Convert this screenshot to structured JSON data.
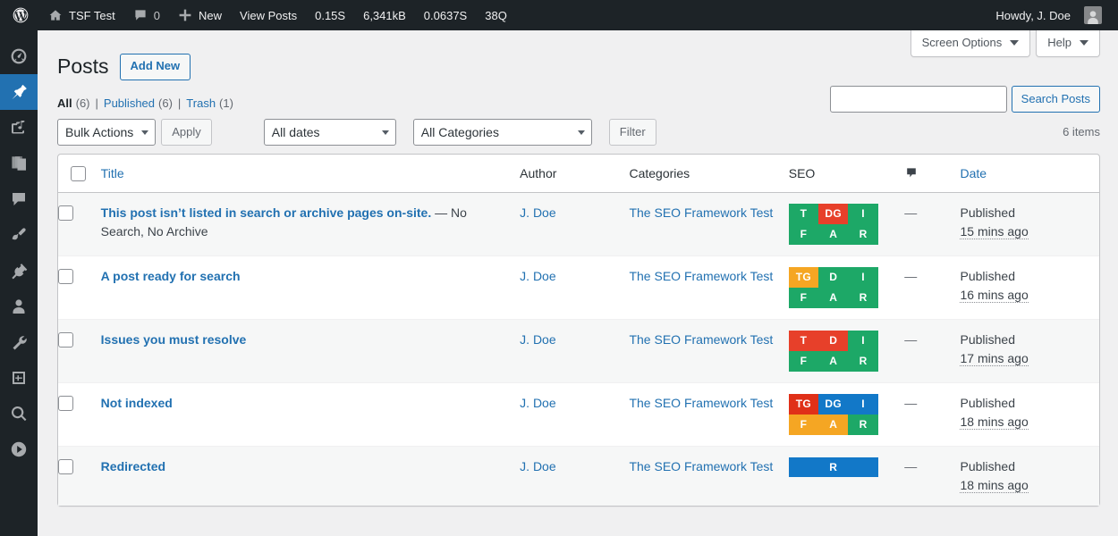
{
  "adminbar": {
    "logo_icon": "wordpress-logo-icon",
    "site_name": "TSF Test",
    "site_icon": "home-icon",
    "comments_icon": "comment-bubble-icon",
    "comments_count": "0",
    "new_icon": "plus-icon",
    "new_label": "New",
    "view_posts_label": "View Posts",
    "perf_time": "0.15S",
    "perf_memory": "6,341kB",
    "perf_time2": "0.0637S",
    "perf_queries": "38Q",
    "howdy": "Howdy, J. Doe",
    "avatar_icon": "user-avatar-icon"
  },
  "sidebar": {
    "items": [
      {
        "name": "dashboard",
        "icon": "dashboard-gauge-icon",
        "current": false
      },
      {
        "name": "posts",
        "icon": "pushpin-icon",
        "current": true
      },
      {
        "name": "media",
        "icon": "media-camera-music-icon",
        "current": false
      },
      {
        "name": "pages",
        "icon": "pages-stack-icon",
        "current": false
      },
      {
        "name": "comments",
        "icon": "comment-bubble-icon",
        "current": false
      },
      {
        "name": "appearance",
        "icon": "paintbrush-icon",
        "current": false
      },
      {
        "name": "plugins",
        "icon": "plug-icon",
        "current": false
      },
      {
        "name": "users",
        "icon": "user-icon",
        "current": false
      },
      {
        "name": "tools",
        "icon": "wrench-icon",
        "current": false
      },
      {
        "name": "settings",
        "icon": "sliders-settings-icon",
        "current": false
      },
      {
        "name": "seo",
        "icon": "magnifier-search-icon",
        "current": false
      },
      {
        "name": "collapse-menu",
        "icon": "play-circle-icon",
        "current": false
      }
    ]
  },
  "screen_meta": {
    "screen_options_label": "Screen Options",
    "help_label": "Help"
  },
  "header": {
    "page_title": "Posts",
    "add_new_label": "Add New"
  },
  "views": {
    "all_label": "All",
    "all_count": "(6)",
    "published_label": "Published",
    "published_count": "(6)",
    "trash_label": "Trash",
    "trash_count": "(1)",
    "divider": "|"
  },
  "search": {
    "value": "",
    "placeholder": "",
    "button_label": "Search Posts"
  },
  "tablenav": {
    "bulk_actions": "Bulk Actions",
    "apply_label": "Apply",
    "all_dates": "All dates",
    "all_categories": "All Categories",
    "filter_label": "Filter",
    "displaying_num": "6 items"
  },
  "table": {
    "columns": {
      "title": "Title",
      "author": "Author",
      "categories": "Categories",
      "seo": "SEO",
      "comments_icon": "comment-bubble-icon",
      "date": "Date"
    },
    "rows": [
      {
        "title": "This post isn’t listed in search or archive pages on-site.",
        "state": "— No Search, No Archive",
        "author": "J. Doe",
        "category": "The SEO Framework Test",
        "comments": "—",
        "date_status": "Published",
        "date_time": "15 mins ago",
        "seo": {
          "layout": "grid",
          "cells": [
            {
              "label": "T",
              "color": "#1da867"
            },
            {
              "label": "DG",
              "color": "#e7402a"
            },
            {
              "label": "I",
              "color": "#1da867"
            },
            {
              "label": "F",
              "color": "#1da867"
            },
            {
              "label": "A",
              "color": "#1da867"
            },
            {
              "label": "R",
              "color": "#1da867"
            }
          ]
        }
      },
      {
        "title": "A post ready for search",
        "state": "",
        "author": "J. Doe",
        "category": "The SEO Framework Test",
        "comments": "—",
        "date_status": "Published",
        "date_time": "16 mins ago",
        "seo": {
          "layout": "grid",
          "cells": [
            {
              "label": "TG",
              "color": "#f5a623"
            },
            {
              "label": "D",
              "color": "#1da867"
            },
            {
              "label": "I",
              "color": "#1da867"
            },
            {
              "label": "F",
              "color": "#1da867"
            },
            {
              "label": "A",
              "color": "#1da867"
            },
            {
              "label": "R",
              "color": "#1da867"
            }
          ]
        }
      },
      {
        "title": "Issues you must resolve",
        "state": "",
        "author": "J. Doe",
        "category": "The SEO Framework Test",
        "comments": "—",
        "date_status": "Published",
        "date_time": "17 mins ago",
        "seo": {
          "layout": "grid",
          "cells": [
            {
              "label": "T",
              "color": "#e7402a"
            },
            {
              "label": "D",
              "color": "#e7402a"
            },
            {
              "label": "I",
              "color": "#1da867"
            },
            {
              "label": "F",
              "color": "#1da867"
            },
            {
              "label": "A",
              "color": "#1da867"
            },
            {
              "label": "R",
              "color": "#1da867"
            }
          ]
        }
      },
      {
        "title": "Not indexed",
        "state": "",
        "author": "J. Doe",
        "category": "The SEO Framework Test",
        "comments": "—",
        "date_status": "Published",
        "date_time": "18 mins ago",
        "seo": {
          "layout": "grid",
          "cells": [
            {
              "label": "TG",
              "color": "#e03018"
            },
            {
              "label": "DG",
              "color": "#1278c8"
            },
            {
              "label": "I",
              "color": "#1278c8"
            },
            {
              "label": "F",
              "color": "#f5a623"
            },
            {
              "label": "A",
              "color": "#f5a623"
            },
            {
              "label": "R",
              "color": "#1da867"
            }
          ]
        }
      },
      {
        "title": "Redirected",
        "state": "",
        "author": "J. Doe",
        "category": "The SEO Framework Test",
        "comments": "—",
        "date_status": "Published",
        "date_time": "18 mins ago",
        "seo": {
          "layout": "single",
          "cells": [
            {
              "label": "R",
              "color": "#1278c8"
            }
          ]
        }
      }
    ]
  },
  "colors": {
    "admin_dark": "#1d2327",
    "accent_blue": "#2271b1",
    "current_blue": "#2271b1",
    "page_bg": "#f0f0f1",
    "alt_row": "#f6f7f7",
    "seo_good": "#1da867",
    "seo_bad": "#e7402a",
    "seo_warn": "#f5a623",
    "seo_info": "#1278c8"
  }
}
